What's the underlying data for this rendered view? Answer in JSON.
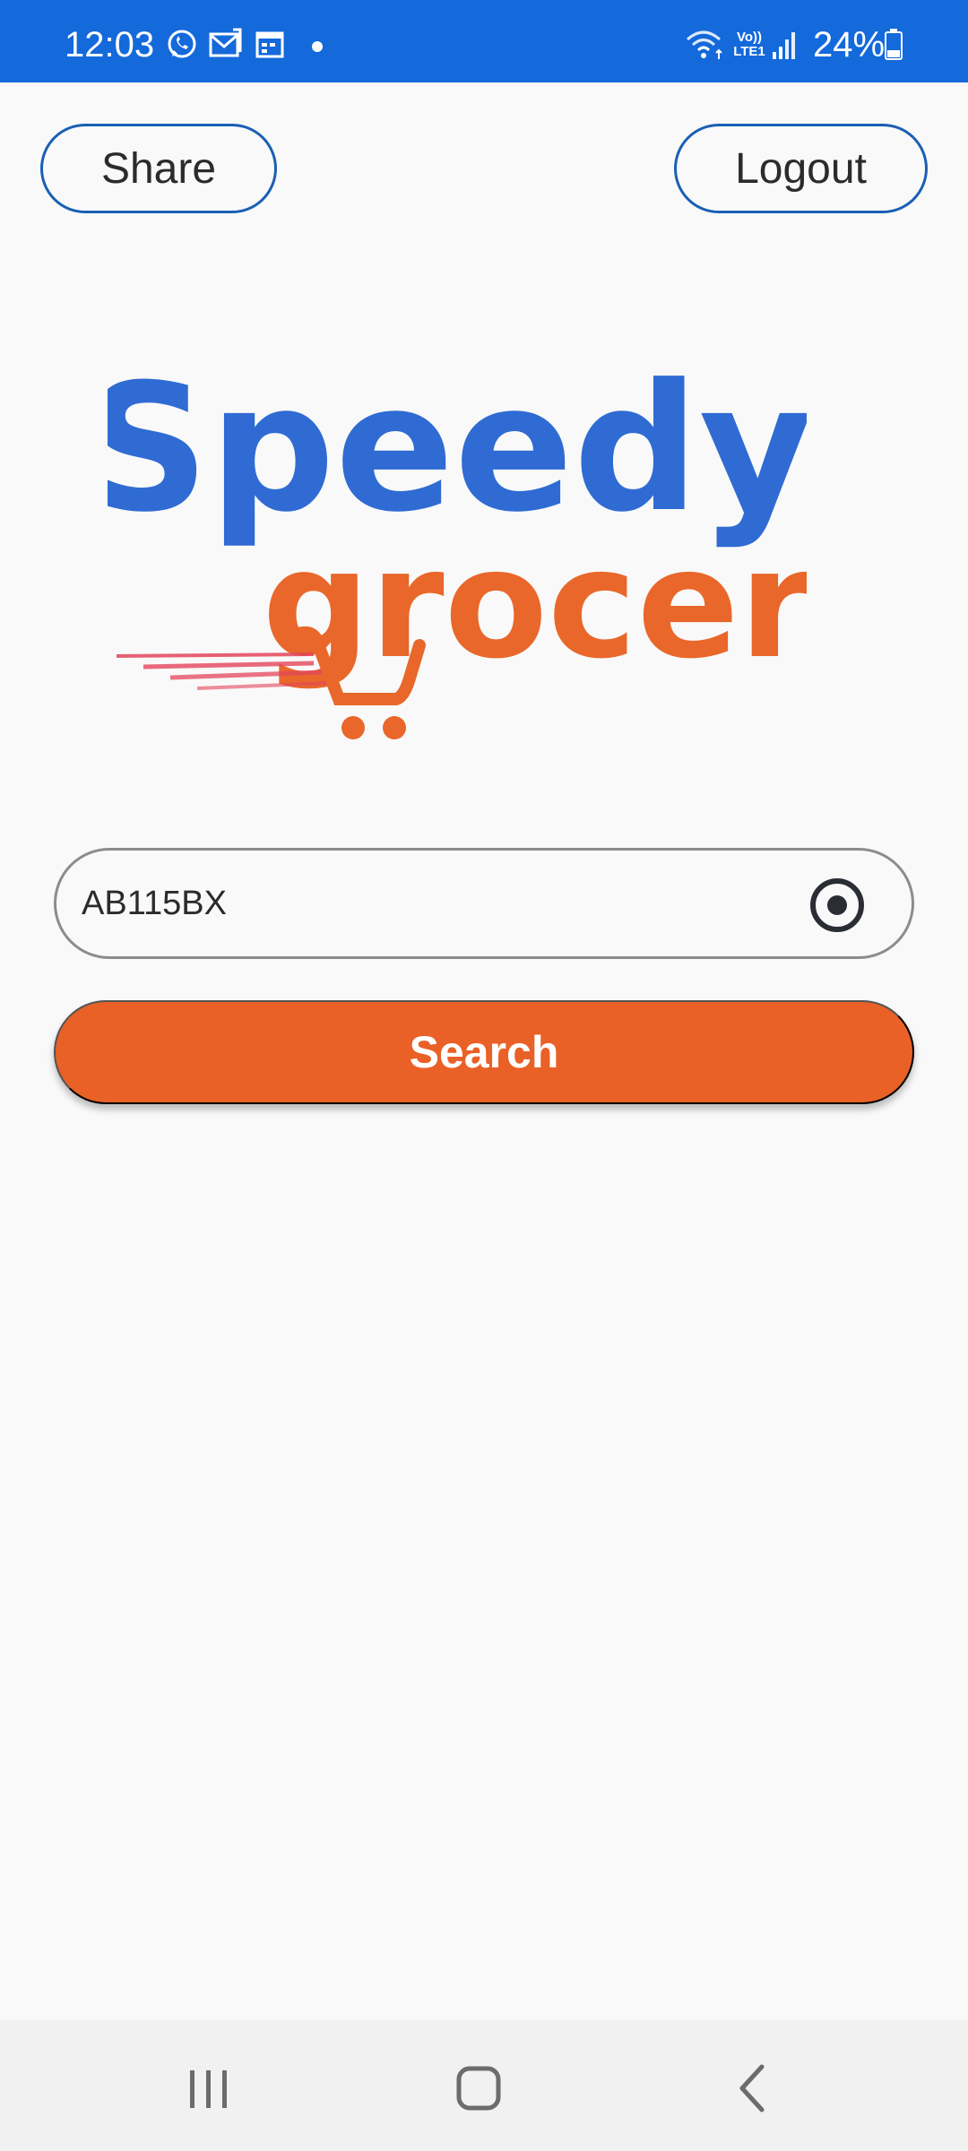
{
  "status_bar": {
    "time": "12:03",
    "battery_text": "24%",
    "lte_text": "Vo)) LTE1",
    "color": "#1469db",
    "icons": [
      "whatsapp-icon",
      "gmail-icon",
      "calendar-icon",
      "dot-icon",
      "wifi-icon",
      "lte-icon",
      "signal-icon",
      "battery-icon"
    ]
  },
  "header": {
    "share_label": "Share",
    "logout_label": "Logout"
  },
  "logo": {
    "line1": "Speedy",
    "line2": "grocer",
    "line1_color": "#2f6bd3",
    "line2_color": "#e9672a"
  },
  "search": {
    "value": "AB115BX",
    "button_label": "Search",
    "button_color": "#e96127",
    "location_icon": "location-target-icon"
  },
  "nav_bar": {
    "icons": [
      "recent-apps-icon",
      "home-icon",
      "back-icon"
    ]
  }
}
